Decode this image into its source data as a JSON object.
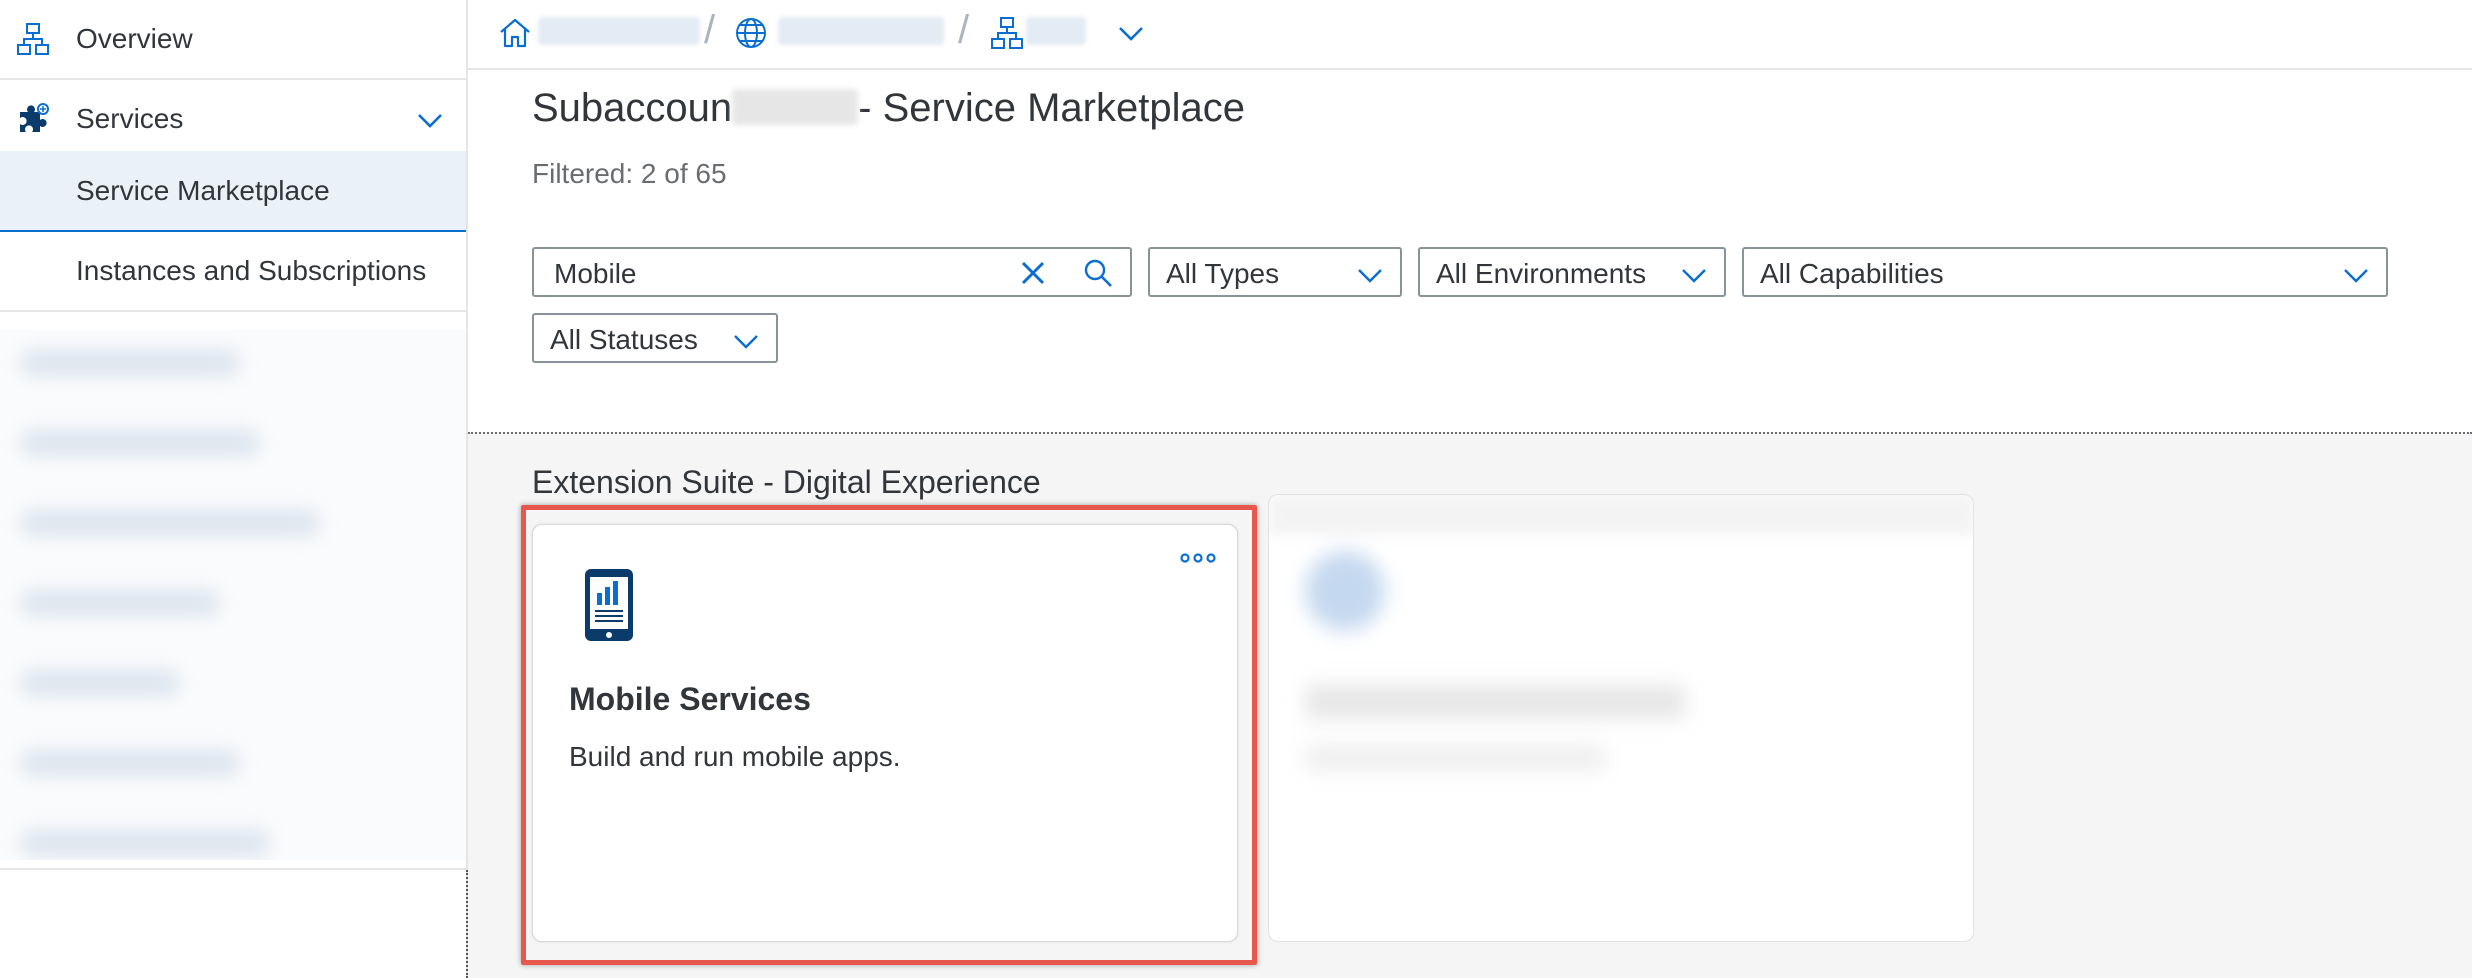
{
  "sidebar": {
    "items": [
      {
        "label": "Overview",
        "icon": "hierarchy-icon"
      },
      {
        "label": "Services",
        "icon": "puzzle-icon",
        "expanded": true
      },
      {
        "label": "Service Marketplace",
        "selected": true
      },
      {
        "label": "Instances and Subscriptions"
      }
    ]
  },
  "breadcrumb": {
    "icons": [
      "home-icon",
      "globe-icon",
      "hierarchy-icon",
      "chevron-down-icon"
    ]
  },
  "header": {
    "title_prefix": "Subaccoun",
    "title_suffix": "- Service Marketplace",
    "filtered_count": "Filtered: 2 of 65"
  },
  "filters": {
    "search_value": "Mobile",
    "type": "All Types",
    "environment": "All Environments",
    "capability": "All Capabilities",
    "status": "All Statuses"
  },
  "section": {
    "title": "Extension Suite - Digital Experience"
  },
  "cards": [
    {
      "title": "Mobile Services",
      "description": "Build and run mobile apps.",
      "icon": "mobile-device-icon"
    }
  ],
  "colors": {
    "accent": "#0a6ed1",
    "icon_dark": "#0b3b6a",
    "selected_bg": "#eaf1f9",
    "highlight": "#e8574b",
    "content_bg": "#f5f5f5"
  }
}
